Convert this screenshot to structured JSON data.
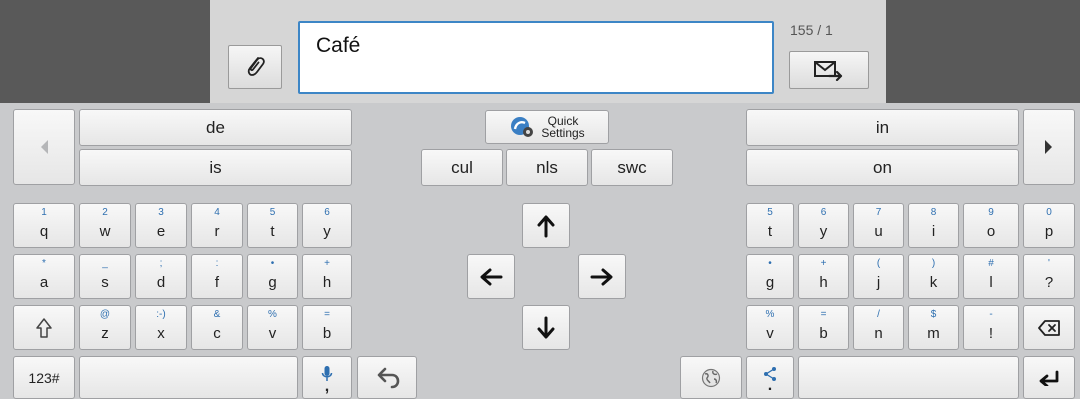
{
  "composer": {
    "message_text": "Café",
    "counter": "155 / 1"
  },
  "suggestions": {
    "left_top": "de",
    "left_bottom": "is",
    "right_top": "in",
    "right_bottom": "on",
    "lang": [
      "cul",
      "nls",
      "swc"
    ],
    "quick_settings_line1": "Quick",
    "quick_settings_line2": "Settings"
  },
  "keyboard": {
    "left_rows": [
      [
        {
          "p": "q",
          "s": "1"
        },
        {
          "p": "w",
          "s": "2"
        },
        {
          "p": "e",
          "s": "3"
        },
        {
          "p": "r",
          "s": "4"
        },
        {
          "p": "t",
          "s": "5"
        },
        {
          "p": "y",
          "s": "6"
        }
      ],
      [
        {
          "p": "a",
          "s": "*"
        },
        {
          "p": "s",
          "s": "_"
        },
        {
          "p": "d",
          "s": ";"
        },
        {
          "p": "f",
          "s": ":"
        },
        {
          "p": "g",
          "s": "•"
        },
        {
          "p": "h",
          "s": "+"
        }
      ],
      [
        {
          "p": "z",
          "s": "@"
        },
        {
          "p": "x",
          "s": ":-)"
        },
        {
          "p": "c",
          "s": "&"
        },
        {
          "p": "v",
          "s": "%"
        },
        {
          "p": "b",
          "s": "="
        }
      ]
    ],
    "right_rows": [
      [
        {
          "p": "t",
          "s": "5"
        },
        {
          "p": "y",
          "s": "6"
        },
        {
          "p": "u",
          "s": "7"
        },
        {
          "p": "i",
          "s": "8"
        },
        {
          "p": "o",
          "s": "9"
        },
        {
          "p": "p",
          "s": "0"
        }
      ],
      [
        {
          "p": "g",
          "s": "•"
        },
        {
          "p": "h",
          "s": "+"
        },
        {
          "p": "j",
          "s": "("
        },
        {
          "p": "k",
          "s": ")"
        },
        {
          "p": "l",
          "s": "#"
        },
        {
          "p": "?",
          "s": "'"
        }
      ],
      [
        {
          "p": "v",
          "s": "%"
        },
        {
          "p": "b",
          "s": "="
        },
        {
          "p": "n",
          "s": "/"
        },
        {
          "p": "m",
          "s": "$"
        },
        {
          "p": "!",
          "s": "-"
        }
      ]
    ],
    "symbols_label": "123#",
    "mic_sub": ",",
    "share_sub": "."
  },
  "icons": {
    "attach": "paperclip-icon",
    "send": "send-message-icon",
    "quick_settings": "quick-settings-icon",
    "arrow_left": "arrow-left-icon",
    "arrow_right": "arrow-right-icon",
    "arrow_up": "arrow-up-icon",
    "arrow_down": "arrow-down-icon",
    "shift": "shift-icon",
    "backspace": "backspace-icon",
    "mic": "microphone-icon",
    "undo": "undo-icon",
    "globe": "globe-icon",
    "share": "share-icon",
    "enter": "enter-icon"
  },
  "colors": {
    "accent": "#3d86c6",
    "secondary_char": "#2e6fb0"
  }
}
